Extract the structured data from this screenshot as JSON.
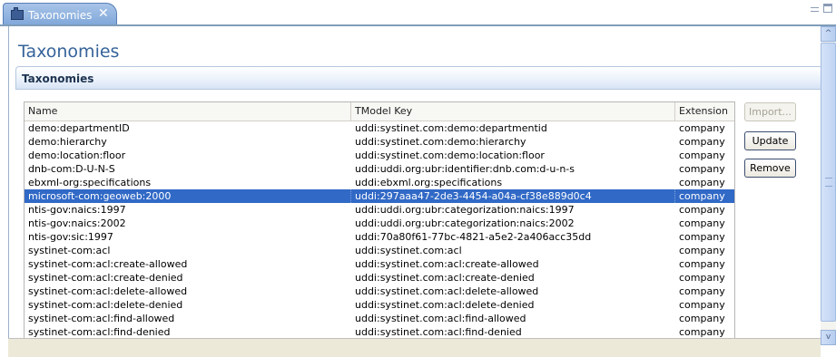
{
  "tab": {
    "label": "Taxonomies",
    "close_glyph": "✕"
  },
  "page": {
    "title": "Taxonomies"
  },
  "section": {
    "title": "Taxonomies"
  },
  "table": {
    "columns": [
      "Name",
      "TModel Key",
      "Extension"
    ],
    "selected_index": 5,
    "rows": [
      {
        "name": "demo:departmentID",
        "key": "uddi:systinet.com:demo:departmentid",
        "ext": "company"
      },
      {
        "name": "demo:hierarchy",
        "key": "uddi:systinet.com:demo:hierarchy",
        "ext": "company"
      },
      {
        "name": "demo:location:floor",
        "key": "uddi:systinet.com:demo:location:floor",
        "ext": "company"
      },
      {
        "name": "dnb-com:D-U-N-S",
        "key": "uddi:uddi.org:ubr:identifier:dnb.com:d-u-n-s",
        "ext": "company"
      },
      {
        "name": "ebxml-org:specifications",
        "key": "uddi:ebxml.org:specifications",
        "ext": "company"
      },
      {
        "name": "microsoft-com:geoweb:2000",
        "key": "uddi:297aaa47-2de3-4454-a04a-cf38e889d0c4",
        "ext": "company"
      },
      {
        "name": "ntis-gov:naics:1997",
        "key": "uddi:uddi.org:ubr:categorization:naics:1997",
        "ext": "company"
      },
      {
        "name": "ntis-gov:naics:2002",
        "key": "uddi:uddi.org:ubr:categorization:naics:2002",
        "ext": "company"
      },
      {
        "name": "ntis-gov:sic:1997",
        "key": "uddi:70a80f61-77bc-4821-a5e2-2a406acc35dd",
        "ext": "company"
      },
      {
        "name": "systinet-com:acl",
        "key": "uddi:systinet.com:acl",
        "ext": "company"
      },
      {
        "name": "systinet-com:acl:create-allowed",
        "key": "uddi:systinet.com:acl:create-allowed",
        "ext": "company"
      },
      {
        "name": "systinet-com:acl:create-denied",
        "key": "uddi:systinet.com:acl:create-denied",
        "ext": "company"
      },
      {
        "name": "systinet-com:acl:delete-allowed",
        "key": "uddi:systinet.com:acl:delete-allowed",
        "ext": "company"
      },
      {
        "name": "systinet-com:acl:delete-denied",
        "key": "uddi:systinet.com:acl:delete-denied",
        "ext": "company"
      },
      {
        "name": "systinet-com:acl:find-allowed",
        "key": "uddi:systinet.com:acl:find-allowed",
        "ext": "company"
      },
      {
        "name": "systinet-com:acl:find-denied",
        "key": "uddi:systinet.com:acl:find-denied",
        "ext": "company"
      }
    ]
  },
  "buttons": {
    "import": "Import...",
    "update": "Update",
    "remove": "Remove",
    "import_enabled": false
  },
  "scrollbar": {
    "up_glyph": "^",
    "down_glyph": "v"
  },
  "colors": {
    "selection": "#3169c6",
    "title": "#36639a",
    "tab": "#7ea6d9"
  }
}
